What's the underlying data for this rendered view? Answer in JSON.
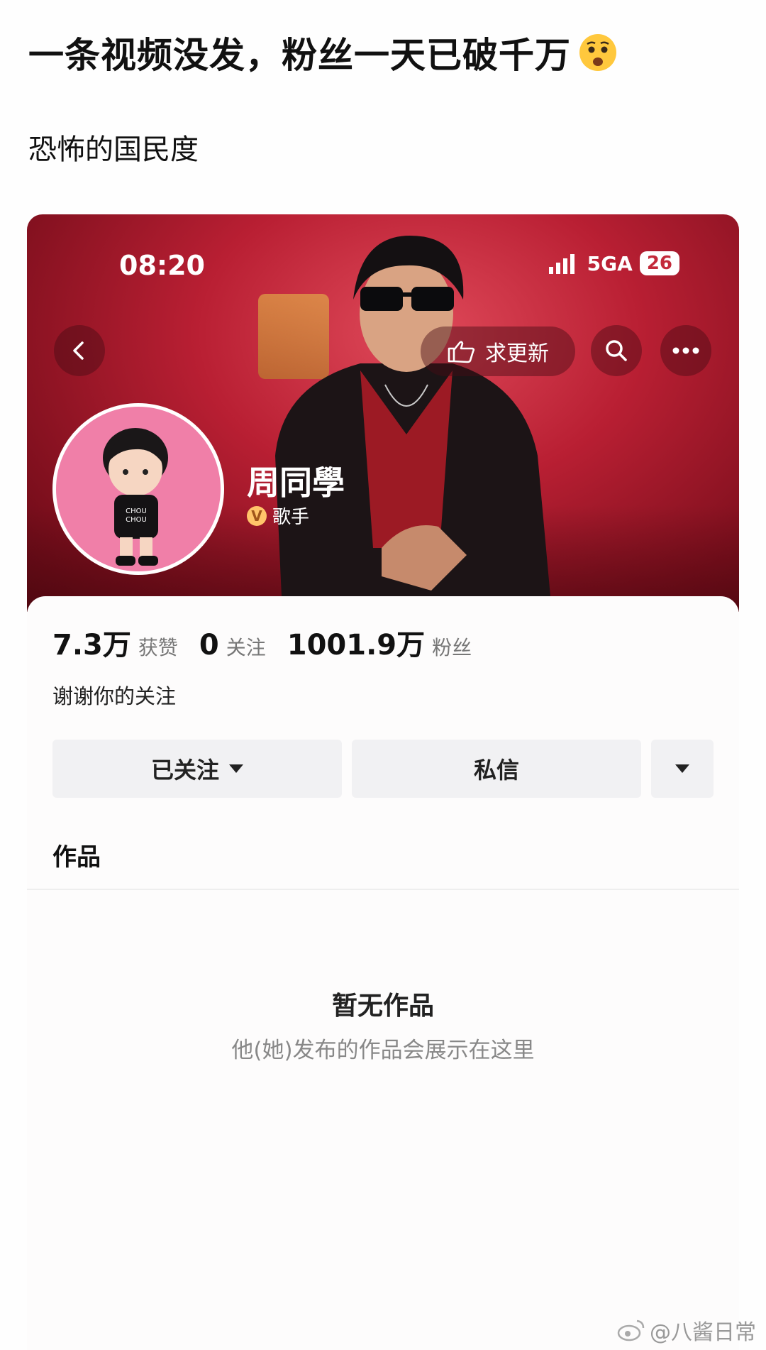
{
  "post": {
    "title": "一条视频没发，粉丝一天已破千万",
    "emoji": "anxious-face-icon",
    "subtitle": "恐怖的国民度"
  },
  "status_bar": {
    "time": "08:20",
    "network": "5GA",
    "battery": "26"
  },
  "header": {
    "update_label": "求更新"
  },
  "profile": {
    "name": "周同學",
    "verify_label": "歌手",
    "verify_badge": "V"
  },
  "stats": [
    {
      "value": "7.3万",
      "label": "获赞"
    },
    {
      "value": "0",
      "label": "关注"
    },
    {
      "value": "1001.9万",
      "label": "粉丝"
    }
  ],
  "bio": "谢谢你的关注",
  "actions": {
    "following_label": "已关注",
    "message_label": "私信"
  },
  "tabs": {
    "works_label": "作品"
  },
  "empty_state": {
    "title": "暂无作品",
    "description": "他(她)发布的作品会展示在这里"
  },
  "watermark": "@八酱日常",
  "colors": {
    "banner": "#b91f33",
    "button_bg": "#f1f1f3",
    "badge": "#ffc46a"
  }
}
